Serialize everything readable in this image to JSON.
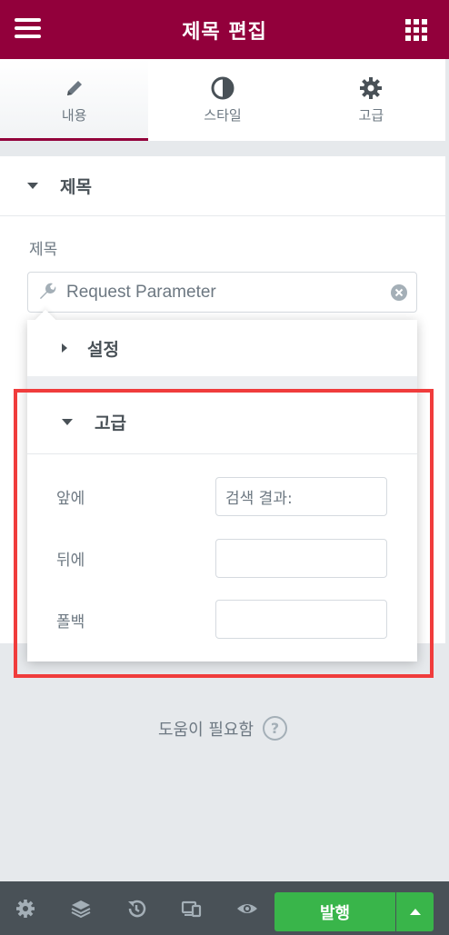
{
  "header": {
    "title": "제목 편집",
    "menu_icon": "hamburger-icon",
    "apps_icon": "grid-icon"
  },
  "tabs": [
    {
      "label": "내용",
      "icon": "pencil-icon",
      "active": true
    },
    {
      "label": "스타일",
      "icon": "contrast-icon",
      "active": false
    },
    {
      "label": "고급",
      "icon": "gear-icon",
      "active": false
    }
  ],
  "section": {
    "title": "제목"
  },
  "title_field": {
    "label": "제목",
    "value": "Request Parameter",
    "icon": "wrench-icon"
  },
  "popover": {
    "settings_title": "설정",
    "advanced_title": "고급",
    "rows": [
      {
        "label": "앞에",
        "value": "검색 결과:"
      },
      {
        "label": "뒤에",
        "value": ""
      },
      {
        "label": "폴백",
        "value": ""
      }
    ]
  },
  "help": {
    "label": "도움이 필요함",
    "icon": "question-icon"
  },
  "footer": {
    "icons": [
      "settings-icon",
      "layers-icon",
      "history-icon",
      "responsive-icon",
      "eye-icon"
    ],
    "publish_label": "발행"
  },
  "colors": {
    "brand": "#92003b",
    "publish": "#39b54a",
    "footer": "#495157",
    "highlight": "#f03c3c"
  }
}
